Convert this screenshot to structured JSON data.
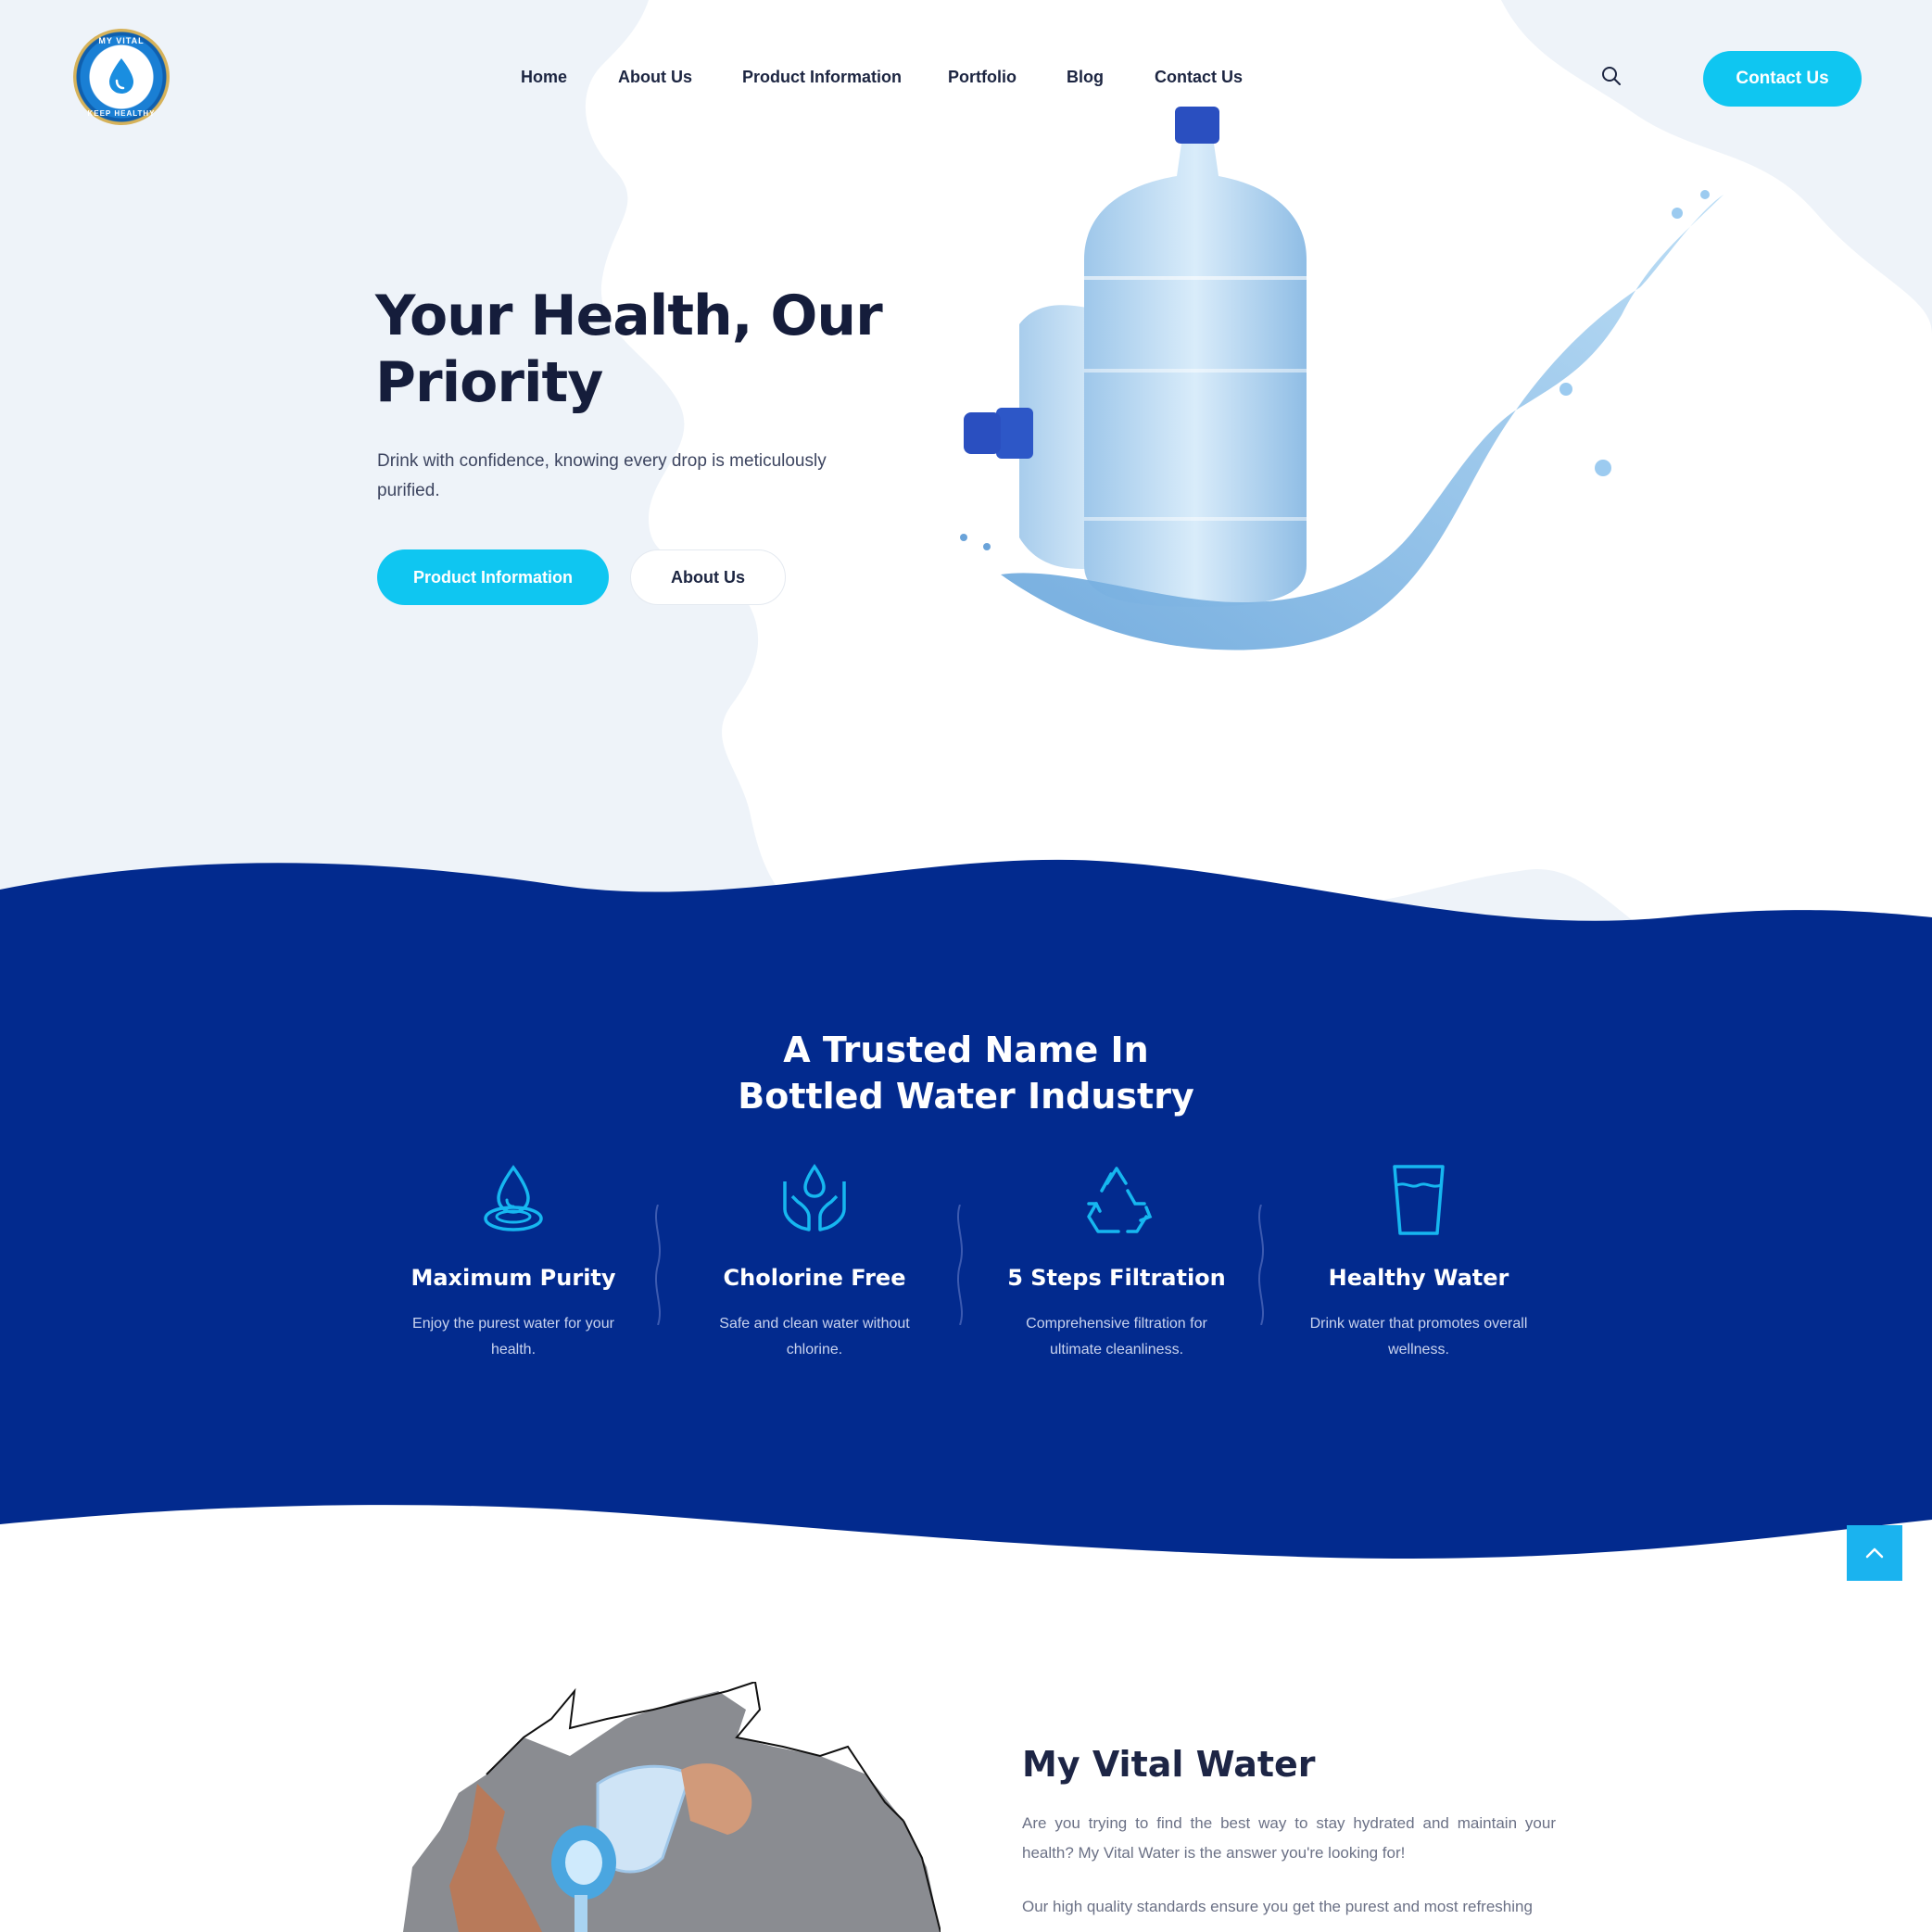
{
  "header": {
    "logo_top_text": "MY VITAL",
    "logo_bottom_text": "KEEP HEALTHY",
    "nav": [
      {
        "label": "Home"
      },
      {
        "label": "About Us"
      },
      {
        "label": "Product Information"
      },
      {
        "label": "Portfolio"
      },
      {
        "label": "Blog"
      },
      {
        "label": "Contact Us"
      }
    ],
    "search_icon": "search-icon",
    "contact_button": "Contact Us"
  },
  "hero": {
    "title": "Your Health, Our Priority",
    "subtitle": "Drink with confidence, knowing every drop is meticulously purified.",
    "primary_button": "Product Information",
    "secondary_button": "About Us"
  },
  "trusted": {
    "title_line1": "A Trusted Name In",
    "title_line2": "Bottled Water Industry",
    "features": [
      {
        "icon": "water-drop-icon",
        "title": "Maximum Purity",
        "desc": "Enjoy the purest water for your health."
      },
      {
        "icon": "hands-drop-icon",
        "title": "Cholorine Free",
        "desc": "Safe and clean water without chlorine."
      },
      {
        "icon": "recycle-icon",
        "title": "5 Steps Filtration",
        "desc": "Comprehensive filtration for ultimate cleanliness."
      },
      {
        "icon": "water-glass-icon",
        "title": "Healthy Water",
        "desc": "Drink water that promotes overall wellness."
      }
    ]
  },
  "about": {
    "title": "My Vital Water",
    "p1": "Are you trying to find the best way to stay hydrated and maintain your health? My Vital Water is the answer you're looking for!",
    "p2": "Our high quality standards ensure you get the purest and most refreshing"
  },
  "colors": {
    "accent": "#0fc6f1",
    "navy": "#022a8e",
    "heading": "#151d3b",
    "hero_bg": "#eef3f9"
  }
}
